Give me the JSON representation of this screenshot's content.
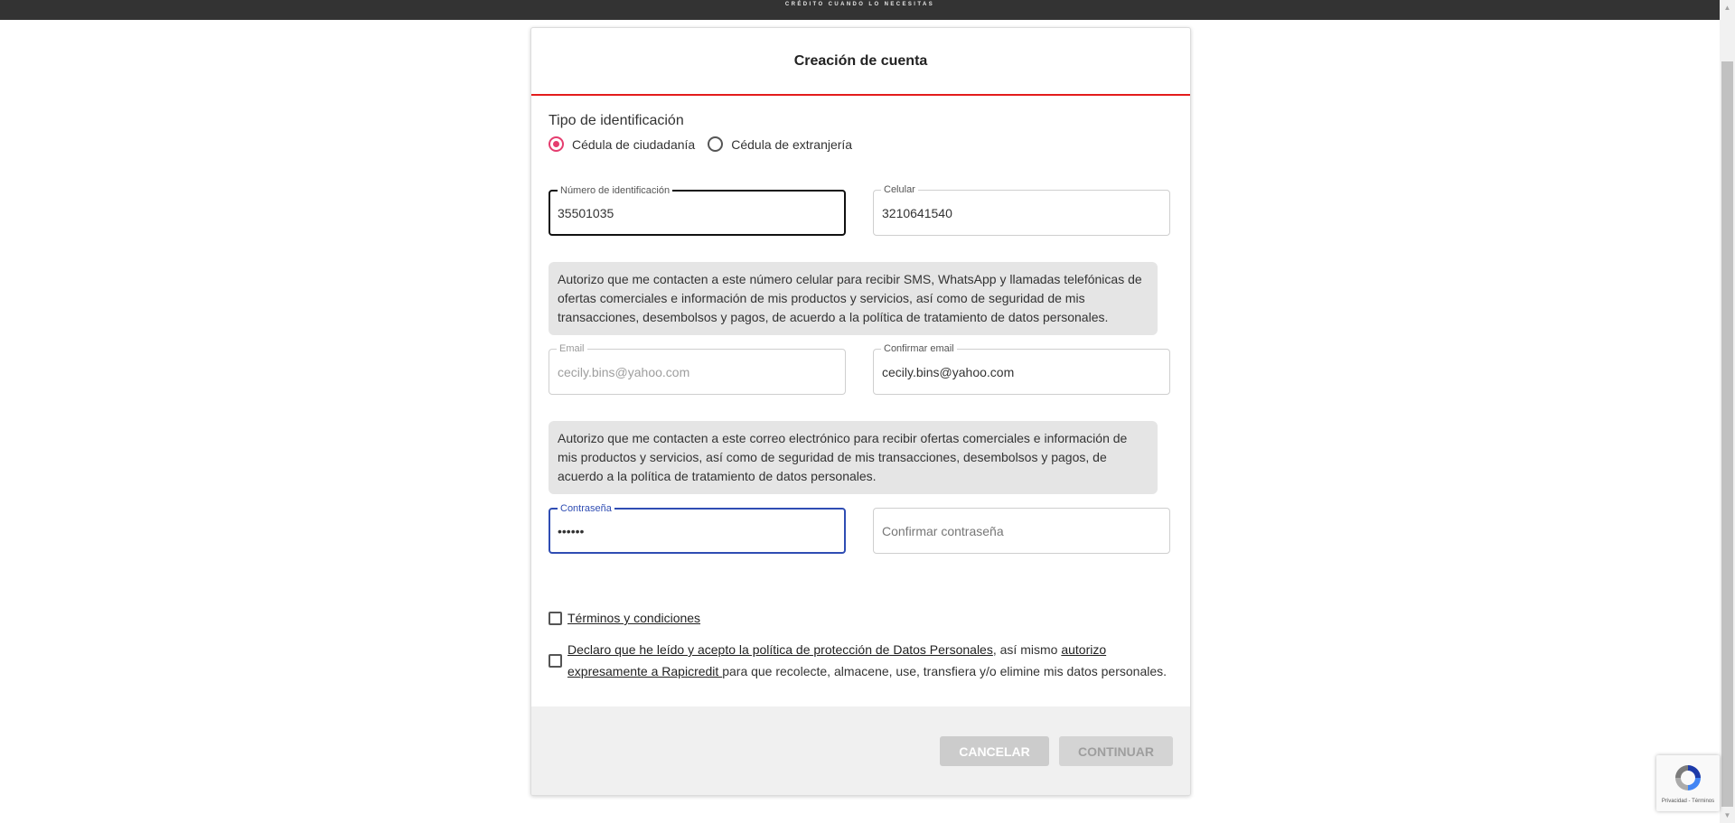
{
  "header": {
    "tagline": "CRÉDITO CUANDO LO NECESITAS"
  },
  "form": {
    "title": "Creación de cuenta",
    "id_type_label": "Tipo de identificación",
    "id_types": [
      {
        "label": "Cédula de ciudadanía",
        "selected": true
      },
      {
        "label": "Cédula de extranjería",
        "selected": false
      }
    ],
    "id_number": {
      "label": "Número de identificación",
      "value": "35501035"
    },
    "phone": {
      "label": "Celular",
      "value": "3210641540"
    },
    "phone_consent": "Autorizo que me contacten a este número celular para recibir SMS, WhatsApp y llamadas telefónicas de ofertas comerciales e información de mis productos y servicios, así como de seguridad de mis transacciones, desembolsos y pagos, de acuerdo a la política de tratamiento de datos personales.",
    "email": {
      "label": "Email",
      "value": "cecily.bins@yahoo.com"
    },
    "confirm_email": {
      "label": "Confirmar email",
      "value": "cecily.bins@yahoo.com"
    },
    "email_consent": "Autorizo que me contacten a este correo electrónico para recibir ofertas comerciales e información de mis productos y servicios, así como de seguridad de mis transacciones, desembolsos y pagos, de acuerdo a la política de tratamiento de datos personales.",
    "password": {
      "label": "Contraseña",
      "value": "••••••"
    },
    "confirm_password": {
      "placeholder": "Confirmar contraseña"
    },
    "terms_link": " Términos y condiciones ",
    "privacy_link": " Declaro que he leído y acepto la política de protección de Datos Personales",
    "privacy_mid": ", así mismo ",
    "privacy_authorize_link": "autorizo expresamente a Rapicredit ",
    "privacy_tail": "para que recolecte, almacene, use, transfiera y/o elimine mis datos personales.",
    "cancel_label": "CANCELAR",
    "continue_label": "CONTINUAR"
  },
  "recaptcha": {
    "footer_text": "Privacidad - Términos"
  },
  "colors": {
    "accent": "#e31c1c",
    "radio": "#e53d6f",
    "focus": "#2f4db3"
  }
}
